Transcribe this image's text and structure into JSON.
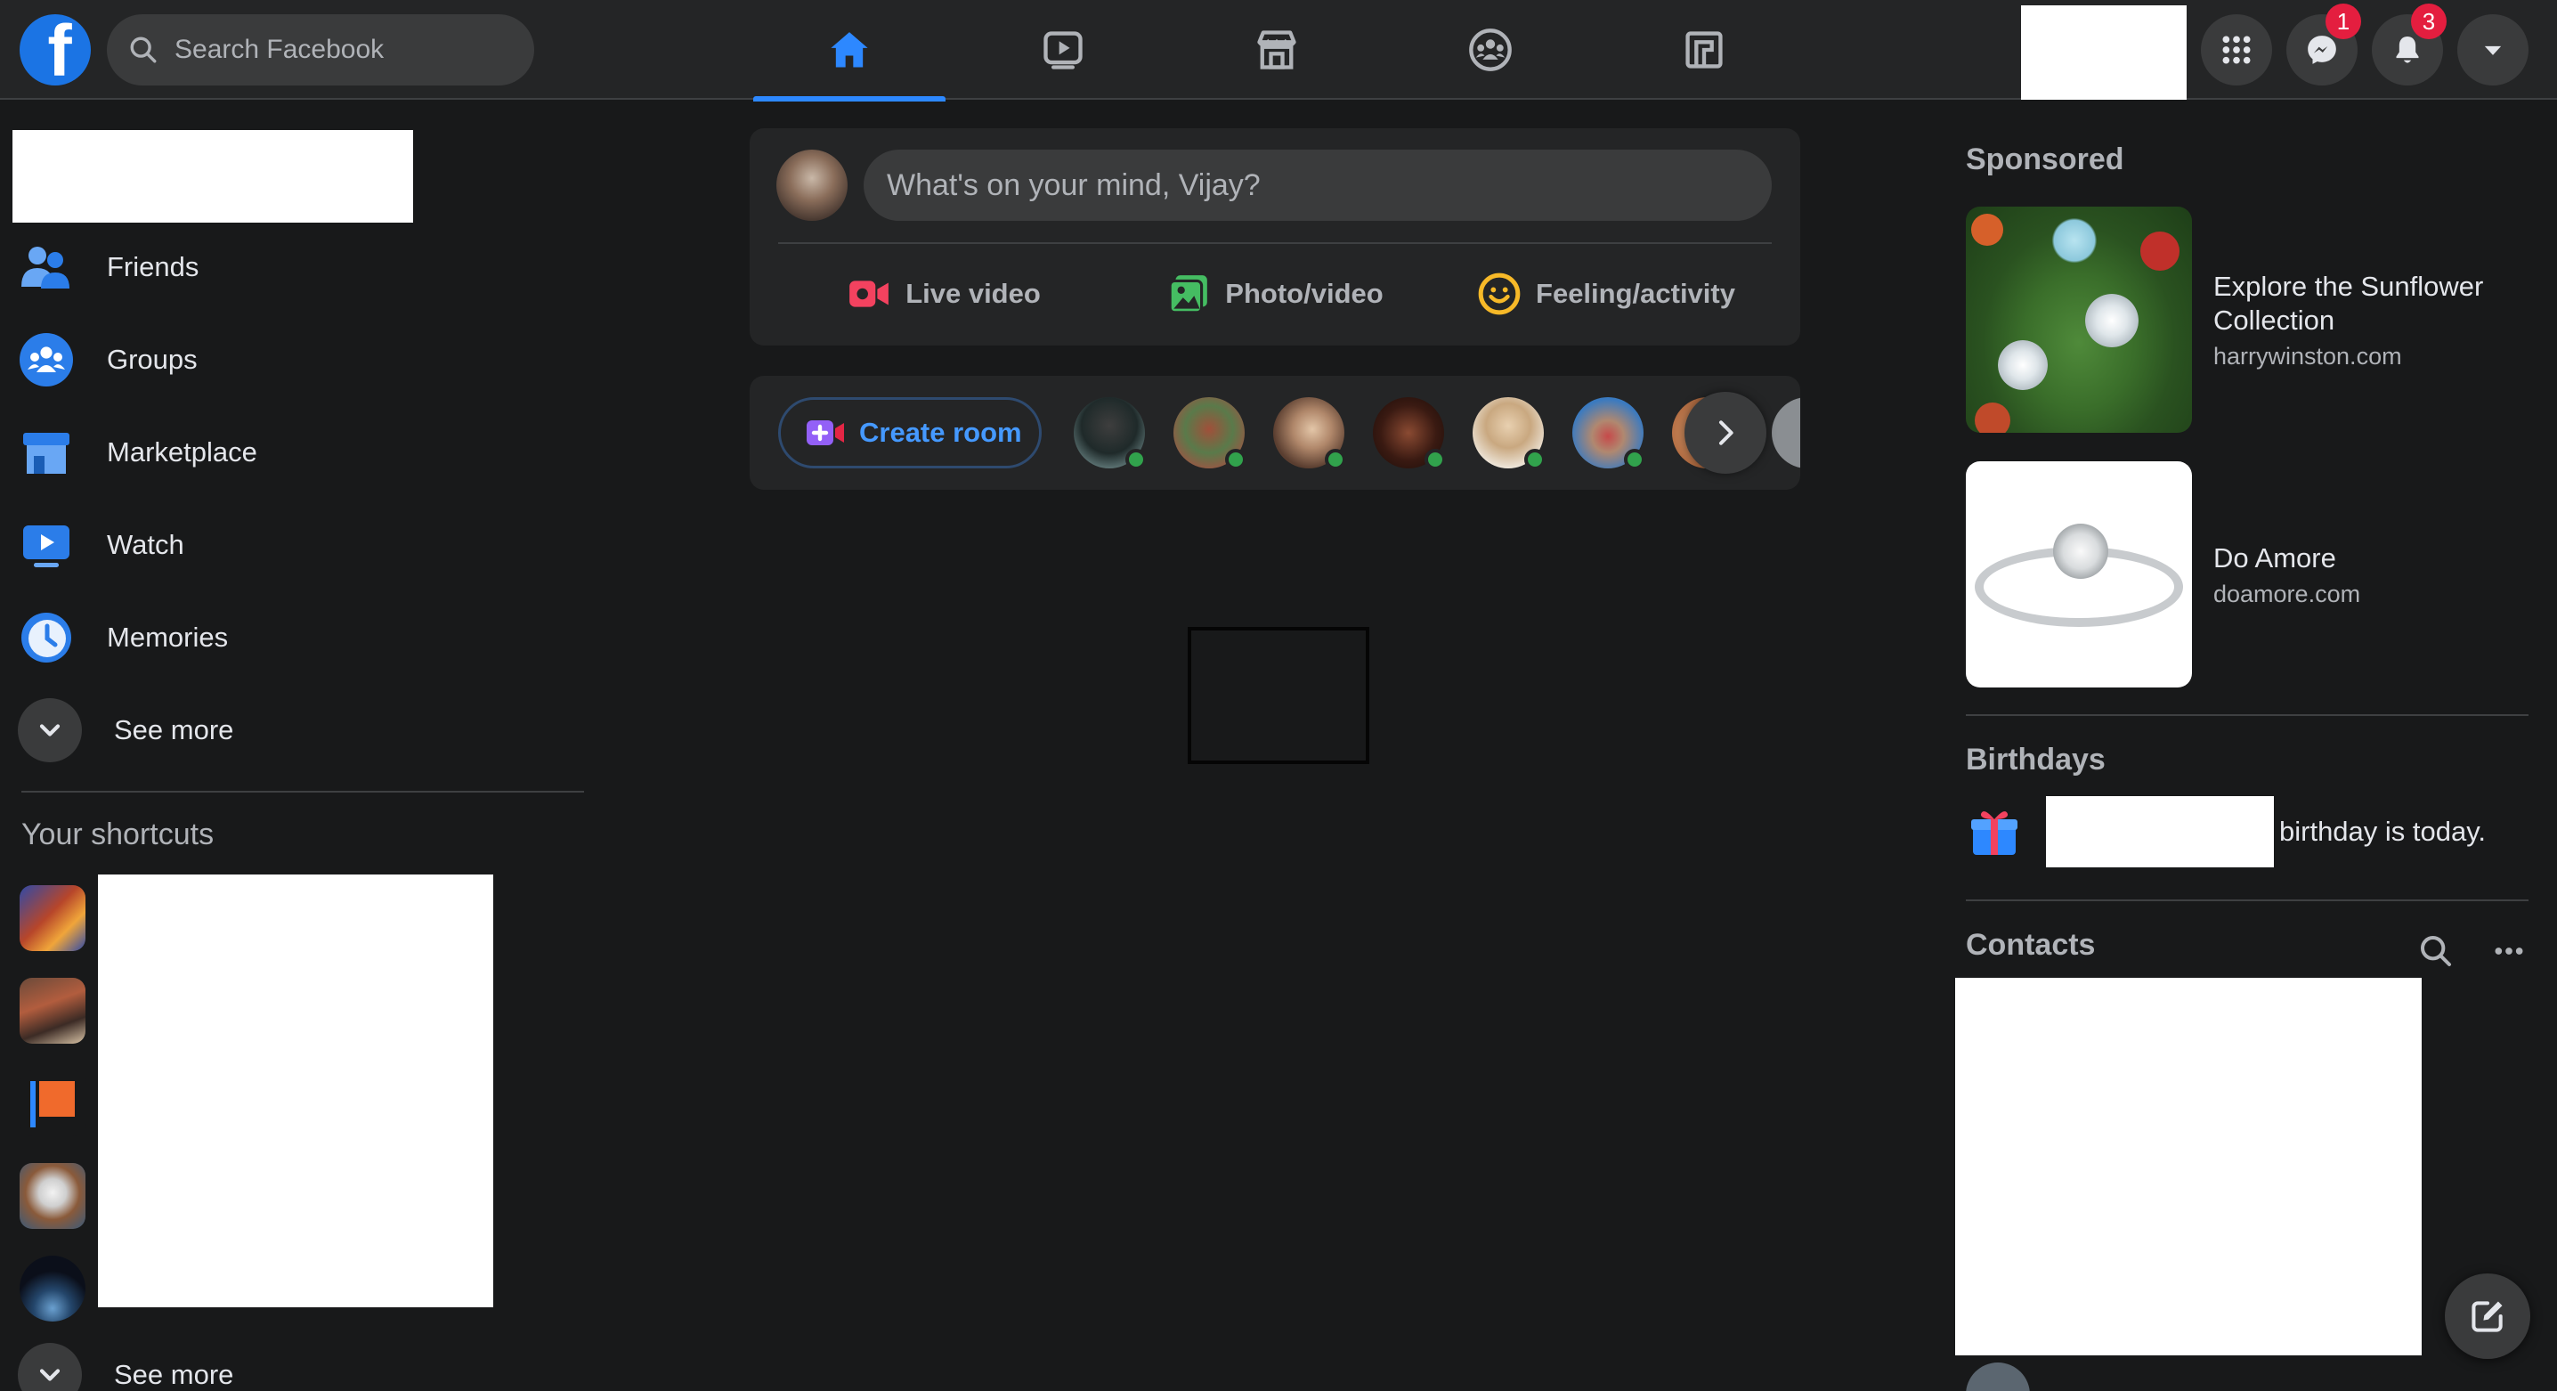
{
  "colors": {
    "background": "#18191a",
    "surface": "#242526",
    "input": "#3a3b3c",
    "accent": "#2d88ff",
    "text_primary": "#e4e6eb",
    "text_secondary": "#b0b3b8",
    "badge": "#e41e3f",
    "online": "#31a24c"
  },
  "header": {
    "logo_letter": "f",
    "search_placeholder": "Search Facebook",
    "nav_tabs": [
      {
        "icon": "home-icon",
        "active": true
      },
      {
        "icon": "watch-icon",
        "active": false
      },
      {
        "icon": "marketplace-icon",
        "active": false
      },
      {
        "icon": "groups-icon",
        "active": false
      },
      {
        "icon": "gaming-icon",
        "active": false
      }
    ],
    "buttons": [
      {
        "icon": "menu-grid-icon"
      },
      {
        "icon": "messenger-icon",
        "badge": "1"
      },
      {
        "icon": "notifications-icon",
        "badge": "3"
      },
      {
        "icon": "account-dropdown-icon"
      }
    ]
  },
  "sidebar": {
    "items": [
      {
        "label": "Friends",
        "icon": "friends-icon"
      },
      {
        "label": "Groups",
        "icon": "groups-icon"
      },
      {
        "label": "Marketplace",
        "icon": "marketplace-icon"
      },
      {
        "label": "Watch",
        "icon": "watch-icon"
      },
      {
        "label": "Memories",
        "icon": "memories-icon"
      },
      {
        "label": "See more",
        "icon": "chevron-down-icon"
      }
    ],
    "shortcuts_title": "Your shortcuts",
    "shortcuts_see_more": "See more"
  },
  "composer": {
    "placeholder": "What's on your mind, Vijay?",
    "actions": [
      {
        "label": "Live video",
        "icon": "live-video-icon",
        "color": "#f3425f"
      },
      {
        "label": "Photo/video",
        "icon": "photo-icon",
        "color": "#45bd62"
      },
      {
        "label": "Feeling/activity",
        "icon": "feeling-icon",
        "color": "#f7b928"
      }
    ]
  },
  "rooms": {
    "create_label": "Create room"
  },
  "right": {
    "sponsored_title": "Sponsored",
    "ads": [
      {
        "name": "Explore the Sunflower Collection",
        "domain": "harrywinston.com"
      },
      {
        "name": "Do Amore",
        "domain": "doamore.com"
      }
    ],
    "birthdays_title": "Birthdays",
    "birthday_text": "birthday is today.",
    "contacts_title": "Contacts"
  }
}
